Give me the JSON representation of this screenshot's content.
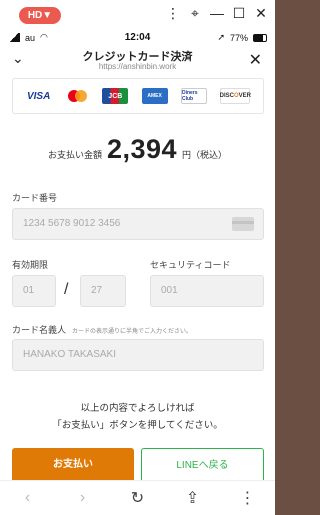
{
  "window": {
    "hd_badge": "HD▼",
    "controls": [
      "⋮",
      "⌖",
      "—",
      "☐",
      "✕"
    ]
  },
  "status_bar": {
    "carrier": "au",
    "time": "12:04",
    "battery": "77%"
  },
  "header": {
    "title": "クレジットカード決済",
    "url": "https://anshinbin.work",
    "back_icon": "chevron-down-icon",
    "close_icon": "close-icon"
  },
  "card_brands": {
    "visa": "VISA",
    "jcb": "JCB",
    "amex": "AMEX",
    "diners": "Diners Club",
    "discover_pre": "DISC",
    "discover_o": "O",
    "discover_post": "VER"
  },
  "amount": {
    "label": "お支払い金額",
    "value": "2,394",
    "unit": "円（税込）"
  },
  "form": {
    "card_number_label": "カード番号",
    "card_number_placeholder": "1234 5678 9012 3456",
    "expiry_label": "有効期限",
    "expiry_month": "01",
    "expiry_separator": "/",
    "expiry_year": "27",
    "security_label": "セキュリティコード",
    "security_placeholder": "001",
    "name_label": "カード名義人",
    "name_hint": "カードの表示通りに半角でご入力ください。",
    "name_placeholder": "HANAKO TAKASAKI"
  },
  "note": {
    "line1": "以上の内容でよろしければ",
    "line2": "「お支払い」ボタンを押してください。"
  },
  "buttons": {
    "pay": "お支払い",
    "back_to_line": "LINEへ戻る"
  },
  "nav": {
    "back": "‹",
    "forward": "›",
    "reload": "↻",
    "share": "⇪",
    "menu": "⋮"
  }
}
